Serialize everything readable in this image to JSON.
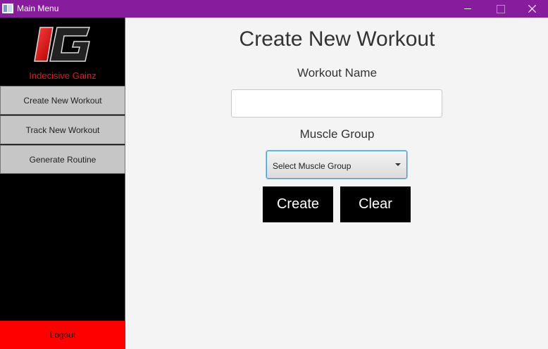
{
  "window": {
    "title": "Main Menu",
    "icons": {
      "app": "app-window-icon",
      "minimize": "minimize-icon",
      "maximize": "maximize-icon",
      "close": "close-icon"
    }
  },
  "sidebar": {
    "logo_text": "IG",
    "brand": "Indecisive Gainz",
    "items": [
      {
        "label": "Create New Workout"
      },
      {
        "label": "Track New Workout"
      },
      {
        "label": "Generate Routine"
      }
    ],
    "logout_label": "Logout"
  },
  "main": {
    "title": "Create New Workout",
    "workout_name_label": "Workout Name",
    "workout_name_value": "",
    "muscle_group_label": "Muscle Group",
    "muscle_group_select": "Select Muscle Group",
    "create_label": "Create",
    "clear_label": "Clear"
  },
  "colors": {
    "titlebar": "#871c9c",
    "sidebar": "#000000",
    "nav_button": "#c6c6c6",
    "logout": "#ff0000",
    "brand_text": "#e8141a",
    "main_bg": "#f4f4f4",
    "action_button": "#000000"
  }
}
